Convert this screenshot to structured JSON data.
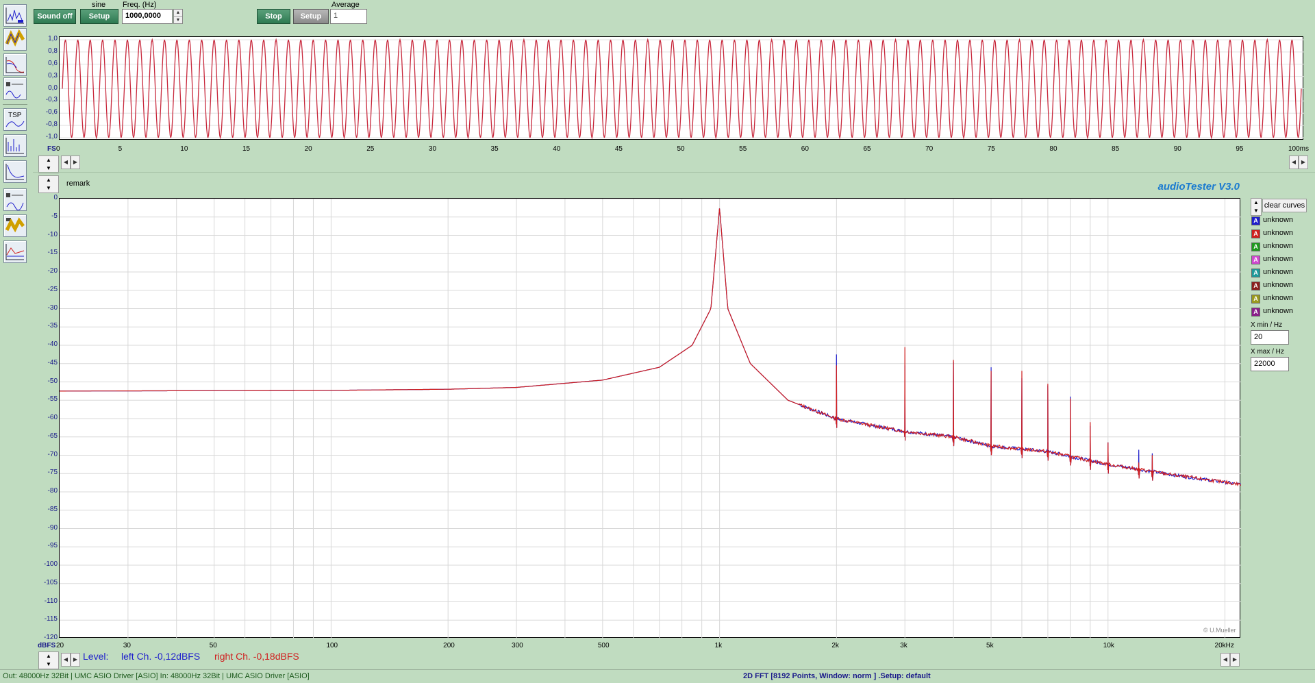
{
  "toolbar": {
    "sound_off_label": "Sound off",
    "generator_type": "sine",
    "setup_label": "Setup",
    "freq_label": "Freq. (Hz)",
    "freq_value": "1000,0000",
    "stop_label": "Stop",
    "setup2_label": "Setup",
    "average_label": "Average",
    "average_value": "1"
  },
  "scope": {
    "y_ticks": [
      "1,0",
      "0,8",
      "0,6",
      "0,3",
      "0,0",
      "-0,3",
      "-0,6",
      "-0,8",
      "-1,0"
    ],
    "x_ticks": [
      "0",
      "5",
      "10",
      "15",
      "20",
      "25",
      "30",
      "35",
      "40",
      "45",
      "50",
      "55",
      "60",
      "65",
      "70",
      "75",
      "80",
      "85",
      "90",
      "95",
      "100ms"
    ],
    "fs_label": "FS",
    "cycles": 100,
    "line_color": "#c8283c"
  },
  "spectrum": {
    "remark": "remark",
    "app_title": "audioTester  V3.0",
    "y_unit": "dBFS",
    "y_ticks": [
      "0",
      "-5",
      "-10",
      "-15",
      "-20",
      "-25",
      "-30",
      "-35",
      "-40",
      "-45",
      "-50",
      "-55",
      "-60",
      "-65",
      "-70",
      "-75",
      "-80",
      "-85",
      "-90",
      "-95",
      "-100",
      "-105",
      "-110",
      "-115",
      "-120"
    ],
    "x_ticks": [
      "20",
      "30",
      "50",
      "100",
      "200",
      "300",
      "500",
      "1k",
      "2k",
      "3k",
      "5k",
      "10k",
      "20kHz"
    ],
    "copyright": "© U.Mueller",
    "left_color": "#1e1ecc",
    "right_color": "#d01e1e"
  },
  "chart_data": {
    "type": "line",
    "xlabel": "",
    "ylabel": "dBFS",
    "x_scale": "log",
    "xlim": [
      20,
      22000
    ],
    "ylim": [
      -120,
      0
    ],
    "grid": true,
    "series": [
      {
        "name": "left Ch. -0,12dBFS",
        "color": "#1e1ecc"
      },
      {
        "name": "right Ch. -0,18dBFS",
        "color": "#d01e1e"
      }
    ],
    "noise_floor": [
      [
        20,
        -52.5
      ],
      [
        100,
        -52.3
      ],
      [
        200,
        -52.0
      ],
      [
        300,
        -51.5
      ],
      [
        500,
        -49.5
      ],
      [
        700,
        -46
      ],
      [
        850,
        -40
      ],
      [
        950,
        -30
      ],
      [
        1000,
        -2.5
      ],
      [
        1050,
        -30
      ],
      [
        1200,
        -45
      ],
      [
        1500,
        -55
      ],
      [
        1990,
        -60
      ],
      [
        2500,
        -62
      ],
      [
        3000,
        -63.5
      ],
      [
        4000,
        -65
      ],
      [
        5000,
        -67.5
      ],
      [
        7000,
        -69
      ],
      [
        10000,
        -72.5
      ],
      [
        15000,
        -75.5
      ],
      [
        22000,
        -78
      ]
    ],
    "harmonics": [
      {
        "f": 2000,
        "left": -42.5,
        "right": -45.5
      },
      {
        "f": 3000,
        "left": -45.5,
        "right": -40.5
      },
      {
        "f": 4000,
        "left": -44.5,
        "right": -44.0
      },
      {
        "f": 5000,
        "left": -46.0,
        "right": -47.0
      },
      {
        "f": 6000,
        "left": -49.0,
        "right": -47.0
      },
      {
        "f": 7000,
        "left": -51.0,
        "right": -50.5
      },
      {
        "f": 8000,
        "left": -54.0,
        "right": -54.5
      },
      {
        "f": 9000,
        "left": -62.0,
        "right": -61.0
      },
      {
        "f": 10000,
        "left": -66.5,
        "right": -66.5
      },
      {
        "f": 12000,
        "left": -68.5,
        "right": -72.0
      },
      {
        "f": 13000,
        "left": -69.5,
        "right": -70.0
      }
    ]
  },
  "legend": {
    "clear_label": "clear curves",
    "items": [
      {
        "label": "unknown",
        "color": "#1e1ecc"
      },
      {
        "label": "unknown",
        "color": "#d01e1e"
      },
      {
        "label": "unknown",
        "color": "#1e9a1e"
      },
      {
        "label": "unknown",
        "color": "#d04ad0"
      },
      {
        "label": "unknown",
        "color": "#1e9a9a"
      },
      {
        "label": "unknown",
        "color": "#8a1e1e"
      },
      {
        "label": "unknown",
        "color": "#9a9a1e"
      },
      {
        "label": "unknown",
        "color": "#8a1e8a"
      }
    ],
    "xmin_label": "X min / Hz",
    "xmin_value": "20",
    "xmax_label": "X max / Hz",
    "xmax_value": "22000"
  },
  "level": {
    "prefix": "Level:",
    "left": "left Ch. -0,12dBFS",
    "right": "right Ch. -0,18dBFS"
  },
  "status": {
    "left": "Out: 48000Hz 32Bit  | UMC ASIO Driver [ASIO]  In: 48000Hz 32Bit  | UMC ASIO Driver [ASIO]",
    "right": "2D FFT [8192 Points, Window: norm ]  .Setup:  default"
  },
  "left_tools": [
    {
      "name": "oscilloscope-icon"
    },
    {
      "name": "recorder-icon"
    },
    {
      "name": "frequency-response-icon"
    },
    {
      "name": "speaker-impedance-icon"
    },
    {
      "name": "tsp-icon",
      "text": "TSP"
    },
    {
      "name": "spectrum-icon"
    },
    {
      "name": "filter-curve-icon"
    },
    {
      "name": "speaker-measure-icon"
    },
    {
      "name": "headphone-icon"
    },
    {
      "name": "phase-icon"
    }
  ]
}
